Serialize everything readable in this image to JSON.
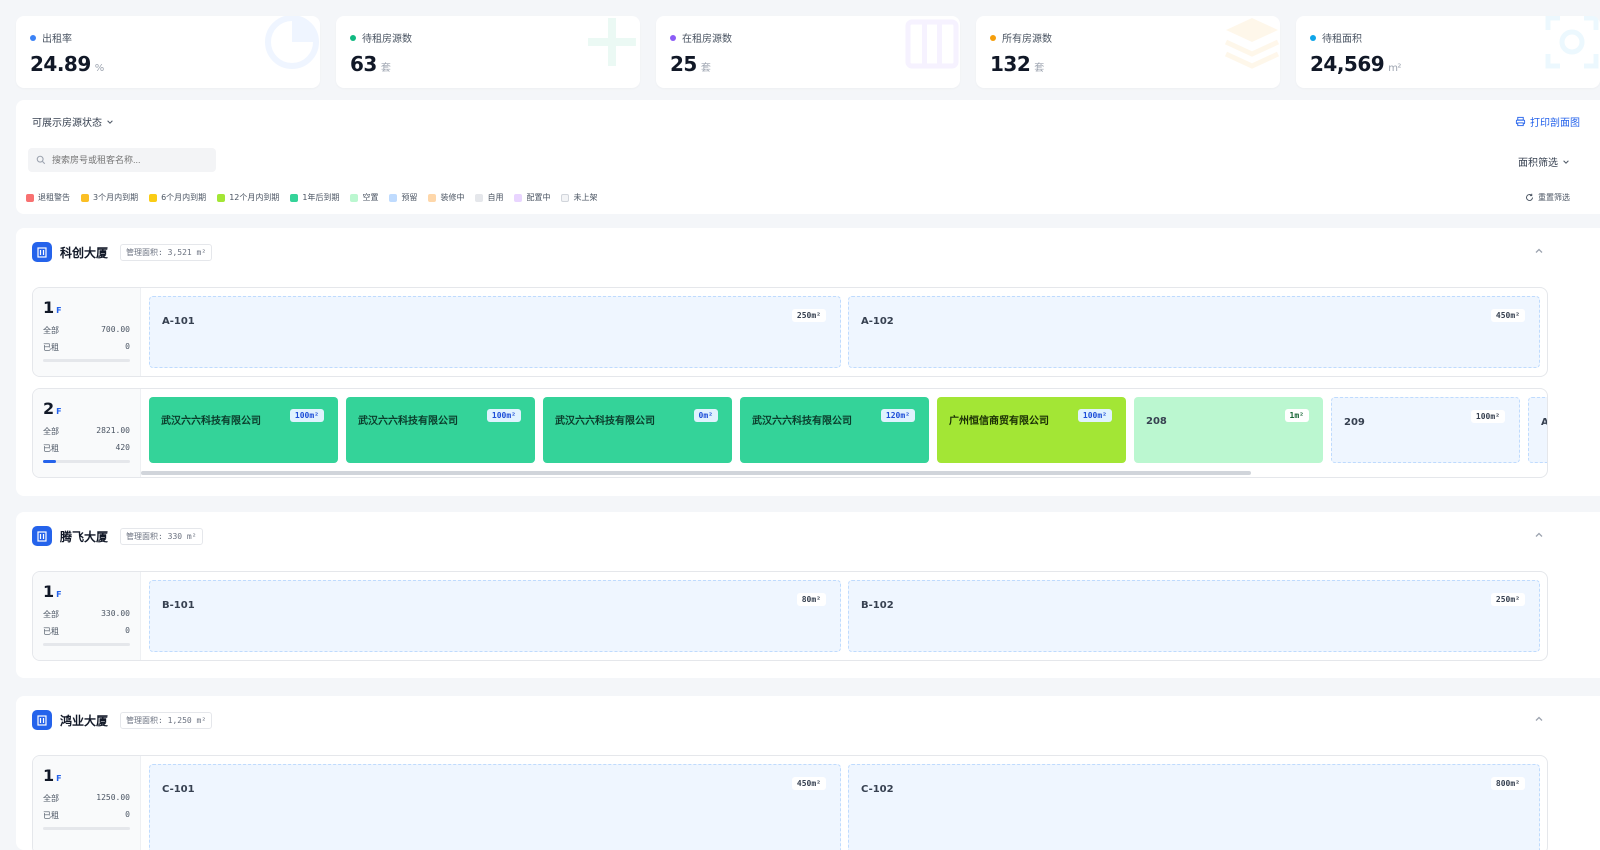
{
  "stats": [
    {
      "label": "出租率",
      "value": "24.89",
      "unit": "%",
      "color": "#3b82f6",
      "icon": "pie-chart-icon"
    },
    {
      "label": "待租房源数",
      "value": "63",
      "unit": "套",
      "color": "#10b981",
      "icon": "plus-icon"
    },
    {
      "label": "在租房源数",
      "value": "25",
      "unit": "套",
      "color": "#8b5cf6",
      "icon": "columns-icon"
    },
    {
      "label": "所有房源数",
      "value": "132",
      "unit": "套",
      "color": "#f59e0b",
      "icon": "layers-icon"
    },
    {
      "label": "待租面积",
      "value": "24,569",
      "unit": "m²",
      "color": "#0ea5e9",
      "icon": "area-icon"
    }
  ],
  "filter": {
    "status_select": "可展示房源状态",
    "print": "打印剖面图",
    "search_placeholder": "搜索房号或租客名称...",
    "area_filter": "面积筛选",
    "reset": "重置筛选"
  },
  "legend": [
    {
      "label": "退租警告",
      "color": "#f87171"
    },
    {
      "label": "3个月内到期",
      "color": "#fbbf24"
    },
    {
      "label": "6个月内到期",
      "color": "#facc15"
    },
    {
      "label": "12个月内到期",
      "color": "#a3e635"
    },
    {
      "label": "1年后到期",
      "color": "#34d399"
    },
    {
      "label": "空置",
      "color": "#bbf7d0"
    },
    {
      "label": "预留",
      "color": "#bfdbfe"
    },
    {
      "label": "装修中",
      "color": "#fed7aa"
    },
    {
      "label": "自用",
      "color": "#e5e7eb"
    },
    {
      "label": "配置中",
      "color": "#e9d5ff"
    },
    {
      "label": "未上架",
      "color": "#f3f4f6"
    }
  ],
  "buildings": [
    {
      "name": "科创大厦",
      "area": "管理面积: 3,521 m²",
      "floors": [
        {
          "num": "1",
          "f": "F",
          "total_label": "全部",
          "total": "700.00",
          "rented_label": "已租",
          "rented": "0",
          "units": [
            {
              "name": "A-101",
              "tag": "250m²"
            },
            {
              "name": "A-102",
              "tag": "450m²"
            }
          ]
        },
        {
          "num": "2",
          "f": "F",
          "total_label": "全部",
          "total": "2821.00",
          "rented_label": "已租",
          "rented": "420",
          "units": [
            {
              "name": "武汉六六科技有限公司",
              "tag": "100m²"
            },
            {
              "name": "武汉六六科技有限公司",
              "tag": "100m²"
            },
            {
              "name": "武汉六六科技有限公司",
              "tag": "0m²"
            },
            {
              "name": "武汉六六科技有限公司",
              "tag": "120m²"
            },
            {
              "name": "广州恒信商贸有限公司",
              "tag": "100m²"
            },
            {
              "name": "208",
              "tag": "1m²"
            },
            {
              "name": "209",
              "tag": "100m²"
            },
            {
              "name": "A-",
              "tag": ""
            }
          ]
        }
      ]
    },
    {
      "name": "腾飞大厦",
      "area": "管理面积: 330 m²",
      "floors": [
        {
          "num": "1",
          "f": "F",
          "total_label": "全部",
          "total": "330.00",
          "rented_label": "已租",
          "rented": "0",
          "units": [
            {
              "name": "B-101",
              "tag": "80m²"
            },
            {
              "name": "B-102",
              "tag": "250m²"
            }
          ]
        }
      ]
    },
    {
      "name": "鸿业大厦",
      "area": "管理面积: 1,250 m²",
      "floors": [
        {
          "num": "1",
          "f": "F",
          "total_label": "全部",
          "total": "1250.00",
          "rented_label": "已租",
          "rented": "0",
          "units": [
            {
              "name": "C-101",
              "tag": "450m²"
            },
            {
              "name": "C-102",
              "tag": "800m²"
            }
          ]
        }
      ]
    }
  ]
}
